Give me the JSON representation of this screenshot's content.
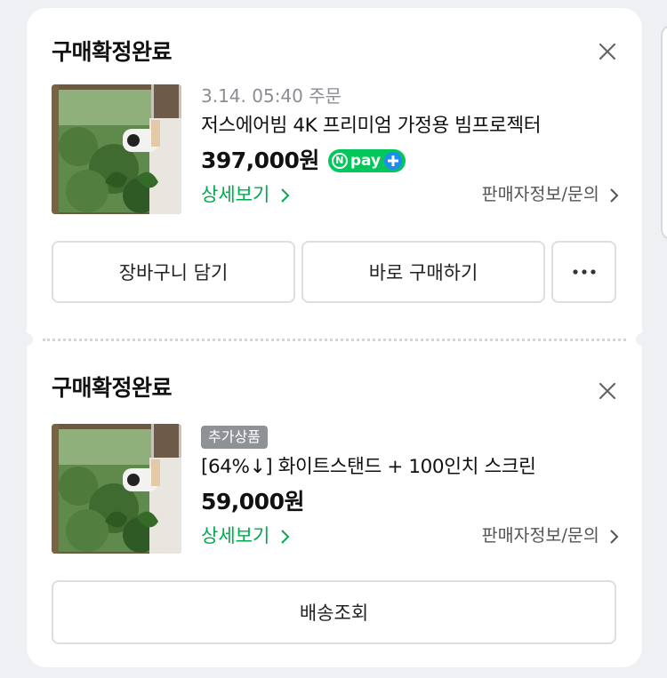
{
  "orders": [
    {
      "status": "구매확정완료",
      "order_date": "3.14. 05:40 주문",
      "product_name": "저스에어빔 4K 프리미엄 가정용 빔프로젝터",
      "price": "397,000원",
      "npay_label": "pay",
      "detail_link": "상세보기",
      "seller_link": "판매자정보/문의",
      "buttons": {
        "cart": "장바구니 담기",
        "buy": "바로 구매하기",
        "more": "···"
      }
    },
    {
      "status": "구매확정완료",
      "badge": "추가상품",
      "product_name": "[64%↓] 화이트스탠드 + 100인치 스크린",
      "price": "59,000원",
      "detail_link": "상세보기",
      "seller_link": "판매자정보/문의",
      "buttons": {
        "track": "배송조회"
      }
    }
  ],
  "icons": {
    "close": "close-icon",
    "chevron": "chevron-right-icon",
    "npay": "npay-plus-logo"
  },
  "colors": {
    "accent_green": "#03a94d",
    "npay_green": "#03c75a",
    "npay_blue": "#1e8cf0",
    "muted_text": "#8a8d92",
    "badge_gray": "#8e9196",
    "background": "#eef0f3"
  }
}
